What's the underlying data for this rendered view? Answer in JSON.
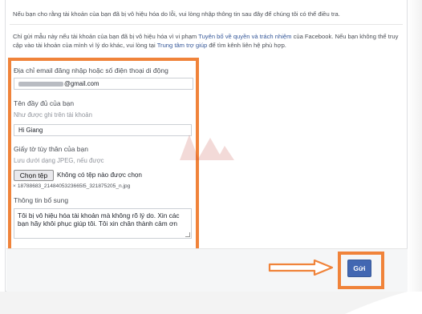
{
  "intro_text": "Nếu bạn cho rằng tài khoản của bạn đã bị vô hiệu hóa do lỗi, vui lòng nhập thông tin sau đây để chúng tôi có thể điều tra.",
  "description": {
    "part1": "Chỉ gửi mẫu này nếu tài khoản của bạn đã bị vô hiệu hóa vì vi phạm ",
    "link1": "Tuyên bố về quyền và trách nhiệm",
    "part2": " của Facebook. Nếu bạn không thể truy cập vào tài khoản của mình vì lý do khác, vui lòng tại ",
    "link2": "Trung tâm trợ giúp",
    "part3": " để tìm kênh liên hệ phù hợp."
  },
  "form": {
    "email_label": "Địa chỉ email đăng nhập hoặc số điện thoại di động",
    "email_value_suffix": "@gmail.com",
    "fullname_label": "Tên đầy đủ của bạn",
    "fullname_hint": "Như được ghi trên tài khoản",
    "fullname_value": "Hi Giang",
    "id_label": "Giấy tờ tùy thân của bạn",
    "id_hint": "Lưu dưới dạng JPEG, nếu được",
    "choose_file_label": "Chọn tệp",
    "no_file_text": "Không có tệp nào được chọn",
    "file_remove_icon": "×",
    "file_name": "18788683_2148405323665l5_321875205_n.jpg",
    "extra_label": "Thông tin bổ sung",
    "extra_value": "Tôi bị vô hiệu hóa tài khoản mà không rõ lý do. Xin các bạn hãy khôi phục giúp tôi. Tôi xin chân thành cảm ơn"
  },
  "submit_label": "Gửi",
  "accent_color": "#f0833a",
  "button_color": "#4267b2"
}
